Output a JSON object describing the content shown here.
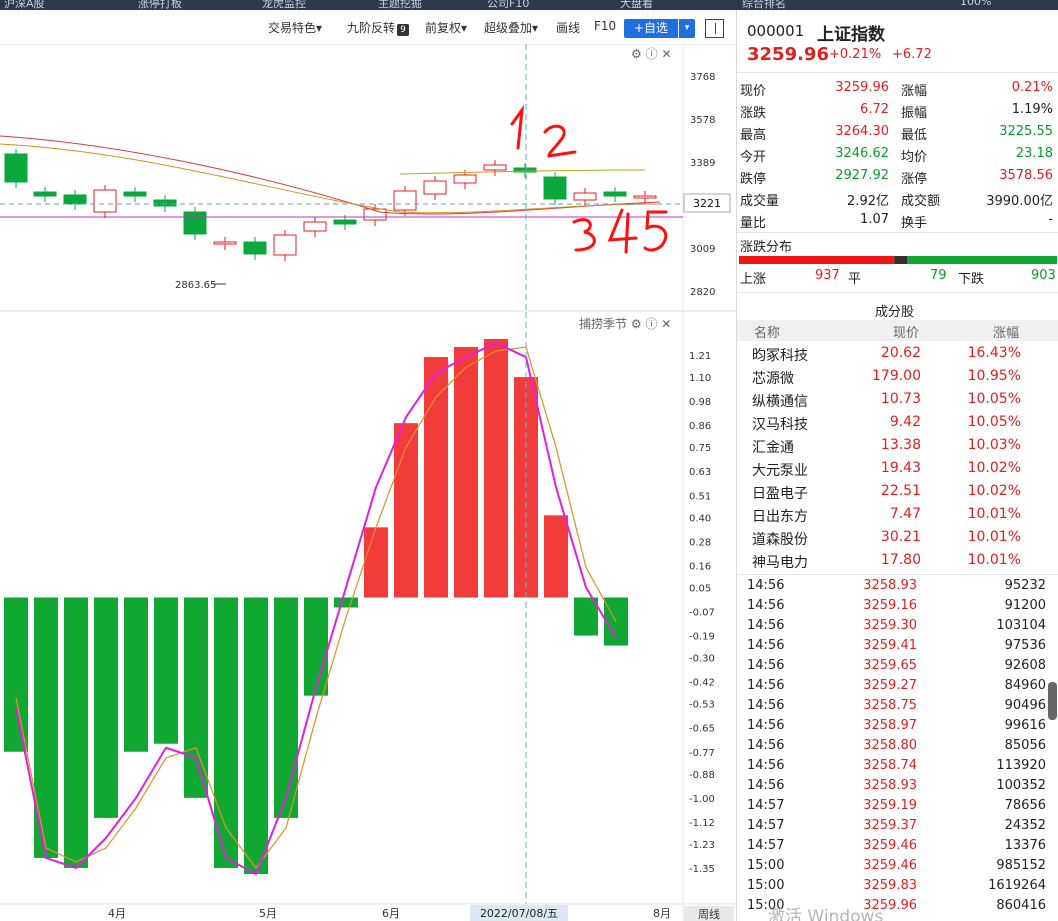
{
  "topnav": {
    "items": [
      "沪深A股",
      "涨停打板",
      "龙虎监控",
      "主题挖掘",
      "公司F10",
      "大盘看",
      "综合排名"
    ],
    "zoom": "100%"
  },
  "toolbar": {
    "items": [
      "交易特色",
      "九阶反转",
      "前复权",
      "超级叠加",
      "画线",
      "F10"
    ],
    "nine_badge": "9",
    "fav_label": "+自选",
    "fav_drop": "▾"
  },
  "kline_chart": {
    "price_ticks": [
      3768,
      3578,
      3389,
      3221,
      3009,
      2820
    ],
    "current_price_tag": "3221",
    "low_annotation": "2863.65",
    "handwritten_top": "1 2",
    "handwritten_bottom": "3 4 5",
    "icons": [
      "settings-icon",
      "help-icon",
      "close-icon"
    ]
  },
  "indicator_chart": {
    "title": "捕捞季节",
    "y_ticks": [
      "1.21",
      "1.10",
      "0.98",
      "0.86",
      "0.75",
      "0.63",
      "0.51",
      "0.40",
      "0.28",
      "0.16",
      "0.05",
      "-0.07",
      "-0.19",
      "-0.30",
      "-0.42",
      "-0.53",
      "-0.65",
      "-0.77",
      "-0.88",
      "-1.00",
      "-1.12",
      "-1.23",
      "-1.35"
    ],
    "x_labels": [
      "4月",
      "5月",
      "6月",
      "8月"
    ],
    "cursor_date": "2022/07/08/五",
    "period": "周线"
  },
  "chart_data": {
    "type": "bar",
    "title": "捕捞季节",
    "ylim": [
      -1.42,
      1.29
    ],
    "values": [
      -0.77,
      -1.3,
      -1.35,
      -1.1,
      -0.77,
      -0.73,
      -1.0,
      -1.35,
      -1.38,
      -1.1,
      -0.49,
      -0.05,
      0.35,
      0.87,
      1.2,
      1.25,
      1.29,
      1.1,
      0.41,
      -0.19,
      -0.24
    ],
    "line_pink": [
      -0.55,
      -1.3,
      -1.35,
      -1.2,
      -1.0,
      -0.75,
      -0.8,
      -1.3,
      -1.38,
      -1.0,
      -0.45,
      0.05,
      0.55,
      0.9,
      1.12,
      1.2,
      1.27,
      1.2,
      0.55,
      0.05,
      -0.2
    ],
    "line_orange": [
      -0.5,
      -1.25,
      -1.32,
      -1.25,
      -1.05,
      -0.8,
      -0.75,
      -1.15,
      -1.35,
      -1.15,
      -0.6,
      -0.1,
      0.35,
      0.75,
      1.0,
      1.15,
      1.23,
      1.25,
      0.75,
      0.15,
      -0.12
    ]
  },
  "quote": {
    "code": "000001",
    "name": "上证指数",
    "price": "3259.96",
    "pct": "+0.21%",
    "change": "+6.72",
    "rows": [
      {
        "l1": "现价",
        "v1": "3259.96",
        "c1": "red",
        "l2": "涨幅",
        "v2": "0.21%",
        "c2": "red"
      },
      {
        "l1": "涨跌",
        "v1": "6.72",
        "c1": "red",
        "l2": "振幅",
        "v2": "1.19%",
        "c2": "dark"
      },
      {
        "l1": "最高",
        "v1": "3264.30",
        "c1": "red",
        "l2": "最低",
        "v2": "3225.55",
        "c2": "green"
      },
      {
        "l1": "今开",
        "v1": "3246.62",
        "c1": "green",
        "l2": "均价",
        "v2": "23.18",
        "c2": "green"
      },
      {
        "l1": "跌停",
        "v1": "2927.92",
        "c1": "green",
        "l2": "涨停",
        "v2": "3578.56",
        "c2": "red"
      },
      {
        "l1": "成交量",
        "v1": "2.92亿",
        "c1": "dark",
        "l2": "成交额",
        "v2": "3990.00亿",
        "c2": "dark"
      },
      {
        "l1": "量比",
        "v1": "1.07",
        "c1": "dark",
        "l2": "换手",
        "v2": "-",
        "c2": "dark"
      }
    ]
  },
  "distribution": {
    "title": "涨跌分布",
    "up_label": "上涨",
    "up_count": 937,
    "flat_label": "平",
    "flat_count": 79,
    "down_label": "下跌",
    "down_count": 903
  },
  "constituents": {
    "title": "成分股",
    "headers": [
      "名称",
      "现价",
      "涨幅"
    ],
    "rows": [
      {
        "name": "昀冢科技",
        "price": "20.62",
        "pct": "16.43%"
      },
      {
        "name": "芯源微",
        "price": "179.00",
        "pct": "10.95%"
      },
      {
        "name": "纵横通信",
        "price": "10.73",
        "pct": "10.05%"
      },
      {
        "name": "汉马科技",
        "price": "9.42",
        "pct": "10.05%"
      },
      {
        "name": "汇金通",
        "price": "13.38",
        "pct": "10.03%"
      },
      {
        "name": "大元泵业",
        "price": "19.43",
        "pct": "10.02%"
      },
      {
        "name": "日盈电子",
        "price": "22.51",
        "pct": "10.02%"
      },
      {
        "name": "日出东方",
        "price": "7.47",
        "pct": "10.01%"
      },
      {
        "name": "道森股份",
        "price": "30.21",
        "pct": "10.01%"
      },
      {
        "name": "神马电力",
        "price": "17.80",
        "pct": "10.01%"
      }
    ]
  },
  "ticks": [
    {
      "time": "14:56",
      "price": "3258.93",
      "vol": "95232"
    },
    {
      "time": "14:56",
      "price": "3259.16",
      "vol": "91200"
    },
    {
      "time": "14:56",
      "price": "3259.30",
      "vol": "103104"
    },
    {
      "time": "14:56",
      "price": "3259.41",
      "vol": "97536"
    },
    {
      "time": "14:56",
      "price": "3259.65",
      "vol": "92608"
    },
    {
      "time": "14:56",
      "price": "3259.27",
      "vol": "84960"
    },
    {
      "time": "14:56",
      "price": "3258.75",
      "vol": "90496"
    },
    {
      "time": "14:56",
      "price": "3258.97",
      "vol": "99616"
    },
    {
      "time": "14:56",
      "price": "3258.80",
      "vol": "85056"
    },
    {
      "time": "14:56",
      "price": "3258.74",
      "vol": "113920"
    },
    {
      "time": "14:56",
      "price": "3258.93",
      "vol": "100352"
    },
    {
      "time": "14:57",
      "price": "3259.19",
      "vol": "78656"
    },
    {
      "time": "14:57",
      "price": "3259.37",
      "vol": "24352"
    },
    {
      "time": "14:57",
      "price": "3259.46",
      "vol": "13376"
    },
    {
      "time": "15:00",
      "price": "3259.46",
      "vol": "985152"
    },
    {
      "time": "15:00",
      "price": "3259.83",
      "vol": "1619264"
    },
    {
      "time": "15:00",
      "price": "3259.96",
      "vol": "860416"
    }
  ],
  "watermark": "激活 Windows"
}
